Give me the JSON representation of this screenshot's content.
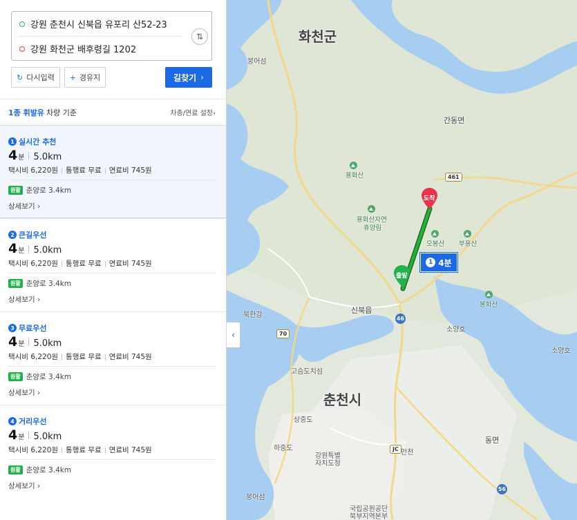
{
  "search": {
    "origin": "강원 춘천시 신북읍 유포리 산52-23",
    "destination": "강원 화천군 배후령길 1202",
    "swap_icon": "⇅",
    "reset_label": "다시입력",
    "reset_icon": "↻",
    "waypoint_label": "경유지",
    "waypoint_icon": "+",
    "submit_label": "길찾기",
    "submit_icon": "›"
  },
  "vehicle": {
    "fuel_type": "1종 휘발유",
    "basis": "차량 기준",
    "settings_label": "차종/연료 설정",
    "settings_icon": "›"
  },
  "routes": [
    {
      "num": "1",
      "name": "실시간 추천",
      "time": "4",
      "time_unit": "분",
      "distance": "5.0km",
      "taxi": "택시비 6,220원",
      "toll": "통행료 무료",
      "fuel": "연료비 745원",
      "road_badge": "원활",
      "road": "춘양로 3.4km",
      "detail": "상세보기 ›",
      "selected": true
    },
    {
      "num": "2",
      "name": "큰길우선",
      "time": "4",
      "time_unit": "분",
      "distance": "5.0km",
      "taxi": "택시비 6,220원",
      "toll": "통행료 무료",
      "fuel": "연료비 745원",
      "road_badge": "원활",
      "road": "춘양로 3.4km",
      "detail": "상세보기 ›",
      "selected": false
    },
    {
      "num": "3",
      "name": "무료우선",
      "time": "4",
      "time_unit": "분",
      "distance": "5.0km",
      "taxi": "택시비 6,220원",
      "toll": "통행료 무료",
      "fuel": "연료비 745원",
      "road_badge": "원활",
      "road": "춘양로 3.4km",
      "detail": "상세보기 ›",
      "selected": false
    },
    {
      "num": "4",
      "name": "거리우선",
      "time": "4",
      "time_unit": "분",
      "distance": "5.0km",
      "taxi": "택시비 6,220원",
      "toll": "통행료 무료",
      "fuel": "연료비 745원",
      "road_badge": "원활",
      "road": "춘양로 3.4km",
      "detail": "상세보기 ›",
      "selected": false
    }
  ],
  "map": {
    "collapse_icon": "‹",
    "destination_pin_label": "도착",
    "origin_pin_label": "출발",
    "route_chip": {
      "num": "1",
      "time": "4분"
    },
    "labels": {
      "hwacheon": "화천군",
      "chuncheon": "춘천시",
      "bongeosan_n": "붕어섬",
      "gandong": "간동면",
      "yonghwasan": "용화산",
      "yonghwa_forest_1": "용화산자연",
      "yonghwa_forest_2": "휴양림",
      "obongsan": "오봉산",
      "buyongsan": "부용산",
      "sinbuk": "신북읍",
      "bukhangang": "북한강",
      "bonghwasan": "봉화산",
      "soyangho_1": "소양호",
      "soyangho_2": "소양호",
      "goeumdochisung": "고슴도치섬",
      "sangjungdo": "상중도",
      "hajungdo": "하중도",
      "gangwon_gov_1": "강원특별",
      "gangwon_gov_2": "자치도청",
      "manchon": "만천",
      "dongmyeon": "동면",
      "bungeoseom_s": "붕어섬",
      "park_1": "국립공원공단",
      "park_2": "북부지역본부"
    },
    "shields": {
      "r461": "461",
      "r70": "70",
      "r46": "46",
      "r56": "56",
      "jc": "JC"
    },
    "colors": {
      "route": "#1fb33e",
      "pin_dest": "#e9334a",
      "pin_origin": "#22b14c",
      "water": "#9ec8ef",
      "road": "#f4d88a",
      "accent": "#1b69e4"
    }
  }
}
